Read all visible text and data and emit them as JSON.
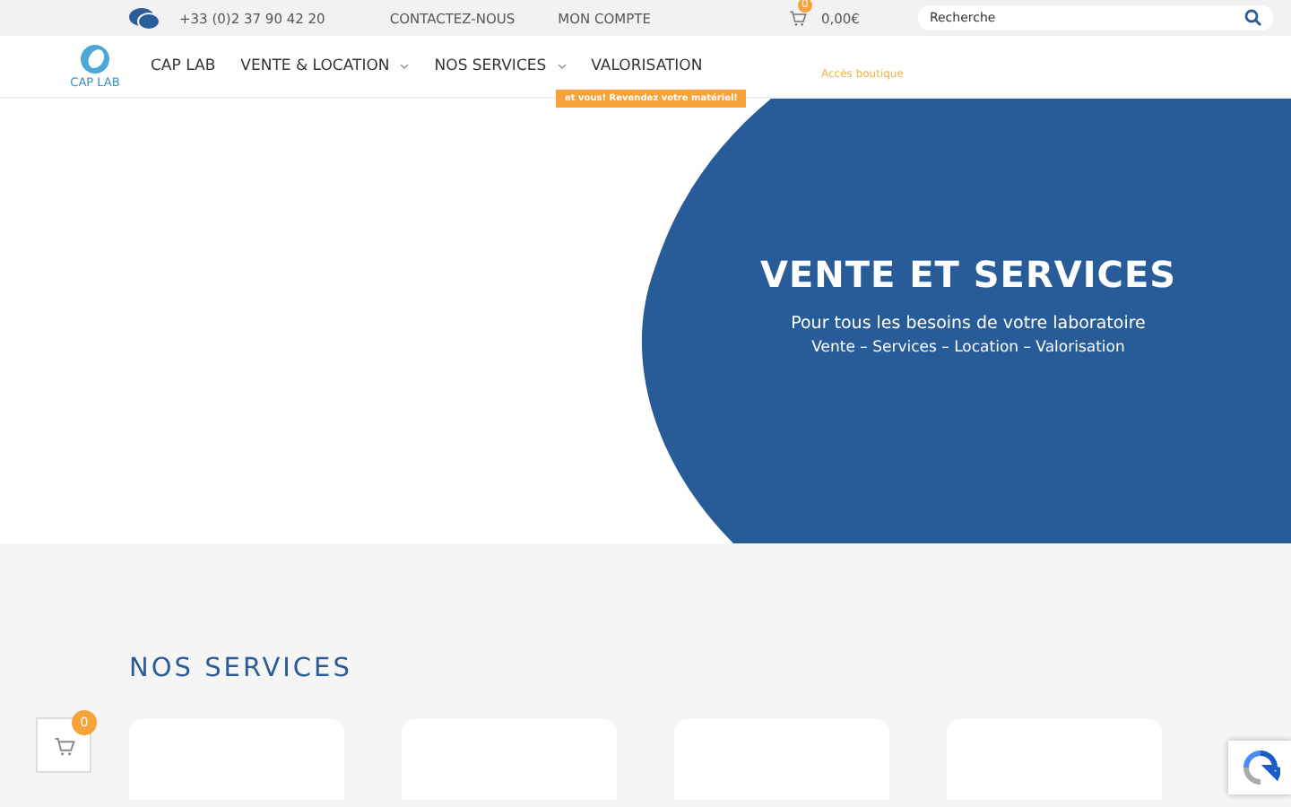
{
  "topbar": {
    "phone": "+33 (0)2 37 90 42 20",
    "links": [
      "CONTACTEZ-NOUS",
      "MON COMPTE"
    ],
    "cart_count": "0",
    "cart_total": "0,00€",
    "search": {
      "placeholder": "Recherche"
    }
  },
  "nav": {
    "logo": "CAP LAB",
    "items": [
      {
        "label": "CAP LAB",
        "dropdown": false
      },
      {
        "label": "VENTE & LOCATION",
        "dropdown": true
      },
      {
        "label": "NOS SERVICES",
        "dropdown": true
      },
      {
        "label": "VALORISATION",
        "dropdown": false
      }
    ],
    "promo": "et vous! Revendez votre matériel!",
    "shop_link": "Accès boutique"
  },
  "hero": {
    "title": "VENTE ET SERVICES",
    "subtitle": "Pour tous les besoins de votre laboratoire",
    "tagline": "Vente – Services – Location – Valorisation"
  },
  "services": {
    "title": "NOS SERVICES"
  },
  "floating_cart": {
    "count": "0"
  }
}
